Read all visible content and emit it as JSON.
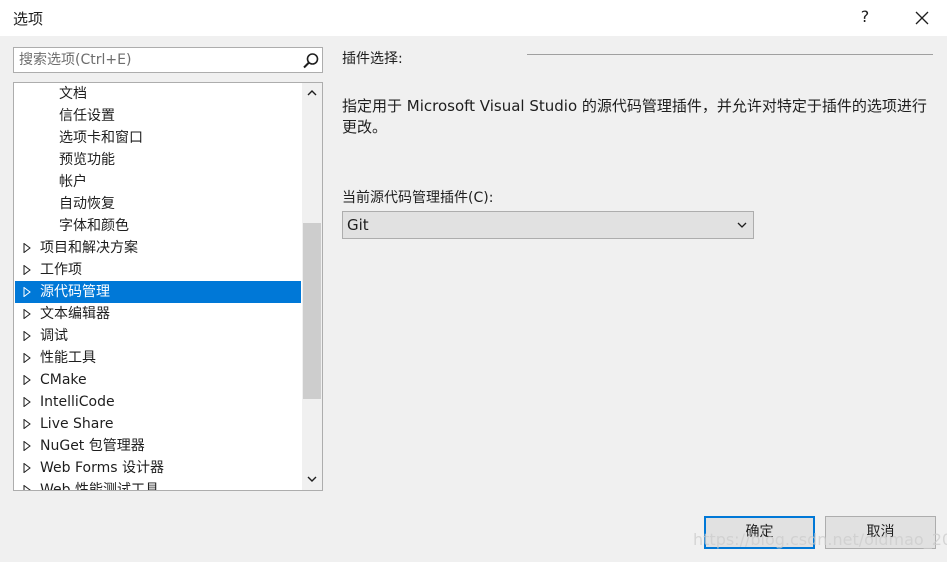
{
  "window": {
    "title": "选项",
    "help_label": "?"
  },
  "search": {
    "placeholder": "搜索选项(Ctrl+E)",
    "value": ""
  },
  "tree": {
    "items": [
      {
        "label": "文档",
        "level": 1,
        "expandable": false,
        "selected": false
      },
      {
        "label": "信任设置",
        "level": 1,
        "expandable": false,
        "selected": false
      },
      {
        "label": "选项卡和窗口",
        "level": 1,
        "expandable": false,
        "selected": false
      },
      {
        "label": "预览功能",
        "level": 1,
        "expandable": false,
        "selected": false
      },
      {
        "label": "帐户",
        "level": 1,
        "expandable": false,
        "selected": false
      },
      {
        "label": "自动恢复",
        "level": 1,
        "expandable": false,
        "selected": false
      },
      {
        "label": "字体和颜色",
        "level": 1,
        "expandable": false,
        "selected": false
      },
      {
        "label": "项目和解决方案",
        "level": 0,
        "expandable": true,
        "selected": false
      },
      {
        "label": "工作项",
        "level": 0,
        "expandable": true,
        "selected": false
      },
      {
        "label": "源代码管理",
        "level": 0,
        "expandable": true,
        "selected": true
      },
      {
        "label": "文本编辑器",
        "level": 0,
        "expandable": true,
        "selected": false
      },
      {
        "label": "调试",
        "level": 0,
        "expandable": true,
        "selected": false
      },
      {
        "label": "性能工具",
        "level": 0,
        "expandable": true,
        "selected": false
      },
      {
        "label": "CMake",
        "level": 0,
        "expandable": true,
        "selected": false
      },
      {
        "label": "IntelliCode",
        "level": 0,
        "expandable": true,
        "selected": false
      },
      {
        "label": "Live Share",
        "level": 0,
        "expandable": true,
        "selected": false
      },
      {
        "label": "NuGet 包管理器",
        "level": 0,
        "expandable": true,
        "selected": false
      },
      {
        "label": "Web Forms 设计器",
        "level": 0,
        "expandable": true,
        "selected": false
      },
      {
        "label": "Web 性能测试工具",
        "level": 0,
        "expandable": true,
        "selected": false
      }
    ]
  },
  "content": {
    "section_title": "插件选择:",
    "description": "指定用于 Microsoft Visual Studio 的源代码管理插件，并允许对特定于插件的选项进行更改。",
    "plugin_label": "当前源代码管理插件(C):",
    "plugin_value": "Git"
  },
  "buttons": {
    "ok_label": "确定",
    "cancel_label": "取消"
  },
  "watermark": "https://blog.csdn.net/oldmao_2001",
  "colors": {
    "selection": "#0078d7",
    "button_focus_border": "#0078d7",
    "dialog_background": "#f0f0f0"
  }
}
